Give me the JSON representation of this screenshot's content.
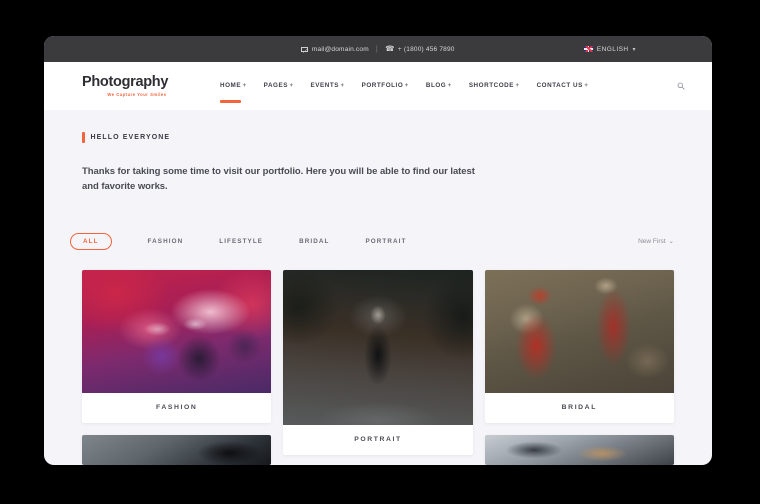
{
  "topbar": {
    "email": "mail@domain.com",
    "separator": "|",
    "phone": "+ (1800) 456 7890",
    "language": "ENGLISH",
    "language_caret": "▾",
    "mail_icon": "mail-icon",
    "phone_icon": "📞",
    "flag_icon": "uk-flag-icon"
  },
  "header": {
    "logo_main": "Photography",
    "logo_tagline": "We Capture Your Smiles",
    "nav": [
      {
        "label": "HOME",
        "plus": "+",
        "active": true
      },
      {
        "label": "PAGES",
        "plus": "+",
        "active": false
      },
      {
        "label": "EVENTS",
        "plus": "+",
        "active": false
      },
      {
        "label": "PORTFOLIO",
        "plus": "+",
        "active": false
      },
      {
        "label": "BLOG",
        "plus": "+",
        "active": false
      },
      {
        "label": "SHORTCODE",
        "plus": "+",
        "active": false
      },
      {
        "label": "CONTACT US",
        "plus": "+",
        "active": false
      }
    ],
    "search_icon": "search-icon"
  },
  "intro": {
    "eyebrow": "HELLO EVERYONE",
    "paragraph": "Thanks for taking some time to visit our portfolio. Here you will be able to find our latest and favorite works."
  },
  "filters": {
    "items": [
      {
        "label": "ALL",
        "active": true
      },
      {
        "label": "FASHION",
        "active": false
      },
      {
        "label": "LIFESTYLE",
        "active": false
      },
      {
        "label": "BRIDAL",
        "active": false
      },
      {
        "label": "PORTRAIT",
        "active": false
      }
    ],
    "sort_label": "New First",
    "sort_caret": "⌄"
  },
  "gallery": {
    "column1": [
      {
        "caption": "FASHION",
        "photo": "ph-fashion",
        "size": "h-std"
      },
      {
        "caption": "",
        "photo": "ph-dark1",
        "size": "h-cut"
      }
    ],
    "column2": [
      {
        "caption": "PORTRAIT",
        "photo": "ph-portrait",
        "size": "h-tall"
      },
      {
        "caption": "",
        "photo": "ph-gravel",
        "size": "h-cut2"
      }
    ],
    "column3": [
      {
        "caption": "BRIDAL",
        "photo": "ph-bridal",
        "size": "h-std"
      },
      {
        "caption": "",
        "photo": "ph-street",
        "size": "h-cut"
      }
    ]
  },
  "colors": {
    "accent": "#f2643c",
    "topbar_bg": "#3b3b3d",
    "page_bg": "#f5f5f9",
    "header_bg": "#ffffff",
    "text_dark": "#3a3a44"
  }
}
